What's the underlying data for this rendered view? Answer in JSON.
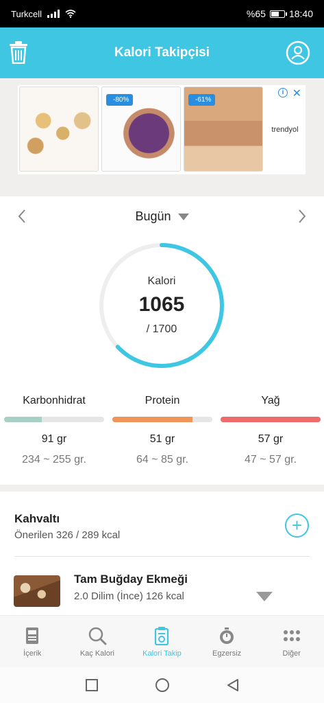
{
  "status": {
    "carrier": "Turkcell",
    "battery": "%65",
    "battery_level": 0.65,
    "time": "18:40"
  },
  "appbar": {
    "title": "Kalori Takipçisi",
    "left_icon": "trash-icon",
    "right_icon": "profile-icon"
  },
  "ad": {
    "badges": [
      "-80%",
      "-61%"
    ],
    "brand": "trendyol",
    "info_icon": "info-icon",
    "close_icon": "close-icon"
  },
  "date": {
    "label": "Bugün"
  },
  "calories": {
    "label": "Kalori",
    "consumed": "1065",
    "goal": "/ 1700",
    "progress": 0.63
  },
  "macros": [
    {
      "name": "Karbonhidrat",
      "value": "91 gr",
      "range": "234 ~ 255 gr.",
      "progress": 0.38,
      "color": "#a6d0c4"
    },
    {
      "name": "Protein",
      "value": "51 gr",
      "range": "64 ~ 85 gr.",
      "progress": 0.8,
      "color": "#f0955a"
    },
    {
      "name": "Yağ",
      "value": "57 gr",
      "range": "47 ~ 57 gr.",
      "progress": 1.0,
      "color": "#ef6b6b"
    }
  ],
  "meal": {
    "title": "Kahvaltı",
    "subtitle": "Önerilen 326 / 289 kcal"
  },
  "food": {
    "name": "Tam Buğday Ekmeği",
    "detail": "2.0 Dilim (İnce) 126 kcal"
  },
  "tabs": [
    {
      "label": "İçerik",
      "icon": "book-icon",
      "active": false
    },
    {
      "label": "Kaç Kalori",
      "icon": "search-icon",
      "active": false
    },
    {
      "label": "Kalori Takip",
      "icon": "clipboard-icon",
      "active": true
    },
    {
      "label": "Egzersiz",
      "icon": "stopwatch-icon",
      "active": false
    },
    {
      "label": "Diğer",
      "icon": "more-dots-icon",
      "active": false
    }
  ],
  "colors": {
    "accent": "#3ec6e3",
    "ring_track": "#eeeeee"
  }
}
